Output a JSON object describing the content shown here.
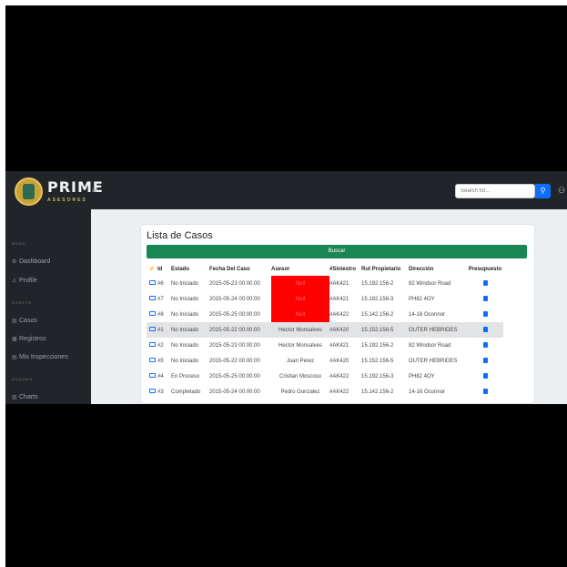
{
  "brand": {
    "name": "PRIME",
    "sub": "ASESORES"
  },
  "topbar": {
    "search_placeholder": "Search for...",
    "toggler": "≡",
    "search_btn": "⚲",
    "user": "⚇"
  },
  "sidebar": {
    "heading_menu": "MENU",
    "item_dashboard": "Dashboard",
    "item_profile": "Profile",
    "heading_2": "SHEETS",
    "item_casos": "Casos",
    "item_registros": "Registros",
    "item_inspecciones": "Mis Inspecciones",
    "heading_3": "ADDONS",
    "item_charts": "Charts",
    "icons": {
      "dashboard": "⚙",
      "profile": "♙",
      "casos": "▤",
      "registros": "▦",
      "inspecciones": "▤",
      "charts": "▥"
    }
  },
  "card": {
    "title": "Lista de Casos",
    "buscar": "Buscar"
  },
  "table": {
    "headers": {
      "action": "⚡",
      "id": "Id",
      "estado": "Estado",
      "fecha": "Fecha Del Caso",
      "asesor": "Asesor",
      "siniestro": "#Siniestro",
      "rut": "Rut Propietario",
      "direccion": "Dirección",
      "presupuesto": "Presupuesto"
    },
    "rows": [
      {
        "id": "#6",
        "estado": "No Iniciado",
        "fecha": "2015-05-23 00:00:00",
        "asesor": "Null",
        "siniestro": "#AK421",
        "rut": "15.192.156-2",
        "direccion": "82 Windsor Road"
      },
      {
        "id": "#7",
        "estado": "No Iniciado",
        "fecha": "2015-05-24 00:00:00",
        "asesor": "Null",
        "siniestro": "#AK421",
        "rut": "15.192.156-3",
        "direccion": "PH82 4OY"
      },
      {
        "id": "#8",
        "estado": "No Iniciado",
        "fecha": "2015-05-25 00:00:00",
        "asesor": "Null",
        "siniestro": "#AK422",
        "rut": "15.142.156-2",
        "direccion": "14-16 Oconnor"
      },
      {
        "id": "#1",
        "estado": "No Iniciado",
        "fecha": "2015-05-22 00:00:00",
        "asesor": "Hector  Monsalves",
        "siniestro": "#AK420",
        "rut": "15.152.156-5",
        "direccion": "OUTER HEBRIDES"
      },
      {
        "id": "#2",
        "estado": "No Iniciado",
        "fecha": "2015-05-23 00:00:00",
        "asesor": "Hector  Monsalves",
        "siniestro": "#AK421",
        "rut": "15.192.156-2",
        "direccion": "82 Windsor Road"
      },
      {
        "id": "#5",
        "estado": "No Iniciado",
        "fecha": "2015-05-22 00:00:00",
        "asesor": "Juan  Perez",
        "siniestro": "#AK420",
        "rut": "15.152.156-5",
        "direccion": "OUTER HEBRIDES"
      },
      {
        "id": "#4",
        "estado": "En Proceso",
        "fecha": "2015-05-25 00:00:00",
        "asesor": "Cristian  Moscoso",
        "siniestro": "#AK422",
        "rut": "15.192.156-3",
        "direccion": "PH82 4OY"
      },
      {
        "id": "#3",
        "estado": "Completado",
        "fecha": "2015-05-24 00:00:00",
        "asesor": "Pedro  Gonzalez",
        "siniestro": "#AK422",
        "rut": "15.142.156-2",
        "direccion": "14-16 Oconnor"
      }
    ]
  },
  "colors": {
    "accent": "#0d6efd",
    "success": "#198754",
    "null_highlight": "#ff0000",
    "dark": "#212529"
  }
}
